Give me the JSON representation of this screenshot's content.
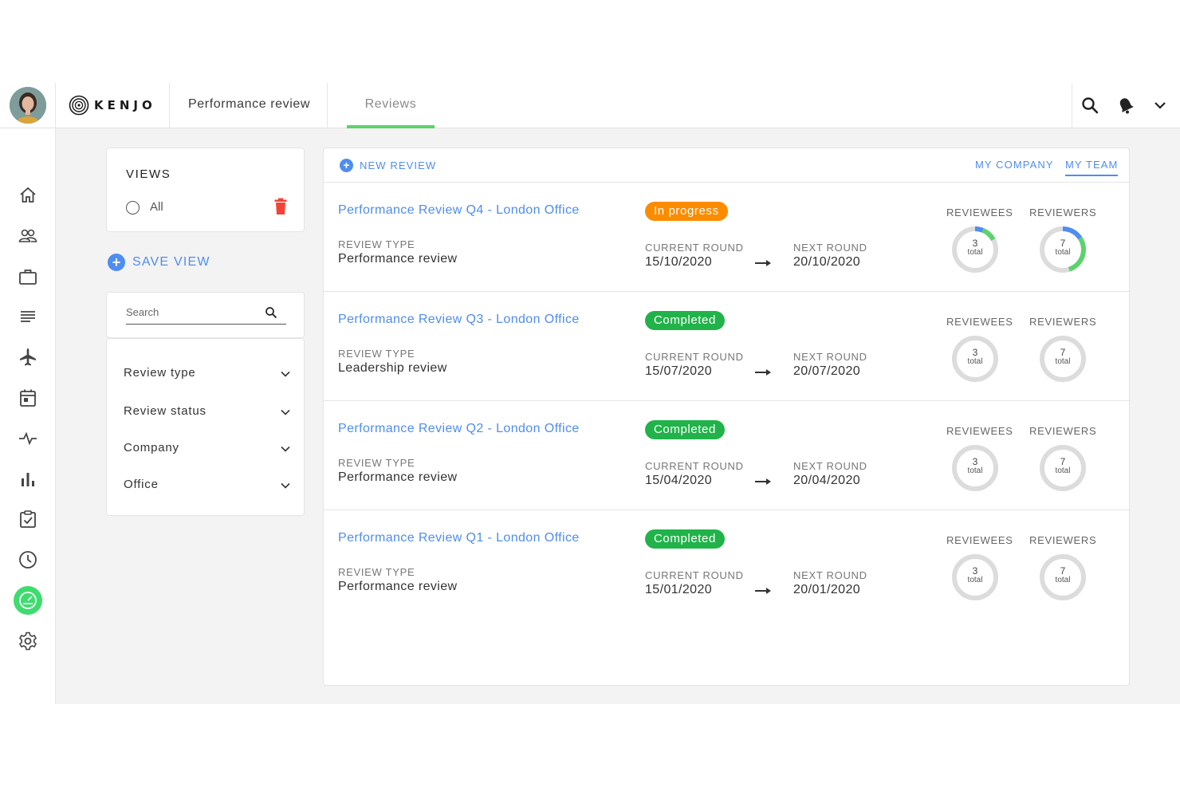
{
  "header": {
    "logo_text": "KENJO",
    "module_title": "Performance review",
    "active_tab": "Reviews"
  },
  "sidebar": {
    "items": [
      {
        "icon": "home-icon"
      },
      {
        "icon": "people-icon"
      },
      {
        "icon": "briefcase-icon"
      },
      {
        "icon": "document-icon"
      },
      {
        "icon": "plane-icon"
      },
      {
        "icon": "calendar-icon"
      },
      {
        "icon": "pulse-icon"
      },
      {
        "icon": "bar-chart-icon"
      },
      {
        "icon": "checklist-icon"
      },
      {
        "icon": "clock-icon"
      },
      {
        "icon": "performance-gauge-icon",
        "active": true
      },
      {
        "icon": "gear-icon"
      }
    ]
  },
  "views": {
    "title": "VIEWS",
    "option_all": "All",
    "save_view": "SAVE VIEW"
  },
  "search": {
    "placeholder": "Search"
  },
  "filters": [
    "Review type",
    "Review status",
    "Company",
    "Office"
  ],
  "list": {
    "new_review": "NEW REVIEW",
    "tab_company": "MY COMPANY",
    "tab_team": "MY TEAM",
    "labels": {
      "review_type": "REVIEW TYPE",
      "current_round": "CURRENT ROUND",
      "next_round": "NEXT ROUND",
      "reviewees": "REVIEWEES",
      "reviewers": "REVIEWERS",
      "total": "total"
    },
    "rows": [
      {
        "title": "Performance Review Q4 - London Office",
        "status": "In progress",
        "status_color": "#fb8c00",
        "review_type": "Performance review",
        "current_round": "15/10/2020",
        "next_round": "20/10/2020",
        "reviewees_total": "3",
        "reviewers_total": "7",
        "reviewees_progress": 0.17,
        "reviewers_progress": 0.45
      },
      {
        "title": "Performance Review Q3 - London Office",
        "status": "Completed",
        "status_color": "#21b34a",
        "review_type": "Leadership review",
        "current_round": "15/07/2020",
        "next_round": "20/07/2020",
        "reviewees_total": "3",
        "reviewers_total": "7",
        "reviewees_progress": 0,
        "reviewers_progress": 0
      },
      {
        "title": "Performance Review Q2 - London Office",
        "status": "Completed",
        "status_color": "#21b34a",
        "review_type": "Performance review",
        "current_round": "15/04/2020",
        "next_round": "20/04/2020",
        "reviewees_total": "3",
        "reviewers_total": "7",
        "reviewees_progress": 0,
        "reviewers_progress": 0
      },
      {
        "title": "Performance Review Q1 - London Office",
        "status": "Completed",
        "status_color": "#21b34a",
        "review_type": "Performance review",
        "current_round": "15/01/2020",
        "next_round": "20/01/2020",
        "reviewees_total": "3",
        "reviewers_total": "7",
        "reviewees_progress": 0,
        "reviewers_progress": 0
      }
    ]
  },
  "colors": {
    "accent_blue": "#4f8df0",
    "accent_green": "#5ad36b",
    "danger_red": "#f44336",
    "donut_track": "#dcdcdc"
  }
}
